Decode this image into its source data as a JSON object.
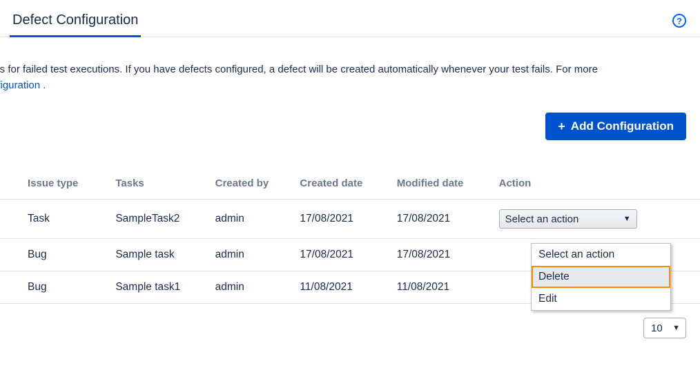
{
  "header": {
    "tab_label": "Defect Configuration",
    "help_glyph": "?"
  },
  "description": {
    "line1_fragment": "cts for failed test executions. If you have defects configured, a defect will be created automatically whenever your test fails. For more",
    "line2_link_fragment": "nfiguration .",
    "add_button_label": "Add Configuration"
  },
  "table": {
    "headers": {
      "issue_type": "Issue type",
      "tasks": "Tasks",
      "created_by": "Created by",
      "created_date": "Created date",
      "modified_date": "Modified date",
      "action": "Action"
    },
    "rows": [
      {
        "issue_type": "Task",
        "tasks": "SampleTask2",
        "created_by": "admin",
        "created_date": "17/08/2021",
        "modified_date": "17/08/2021"
      },
      {
        "issue_type": "Bug",
        "tasks": "Sample task",
        "created_by": "admin",
        "created_date": "17/08/2021",
        "modified_date": "17/08/2021"
      },
      {
        "issue_type": "Bug",
        "tasks": "Sample task1",
        "created_by": "admin",
        "created_date": "11/08/2021",
        "modified_date": "11/08/2021"
      }
    ],
    "action_select": {
      "placeholder": "Select an action",
      "options": [
        "Select an action",
        "Delete",
        "Edit"
      ],
      "highlighted": "Delete"
    }
  },
  "pager": {
    "page_size": "10"
  }
}
